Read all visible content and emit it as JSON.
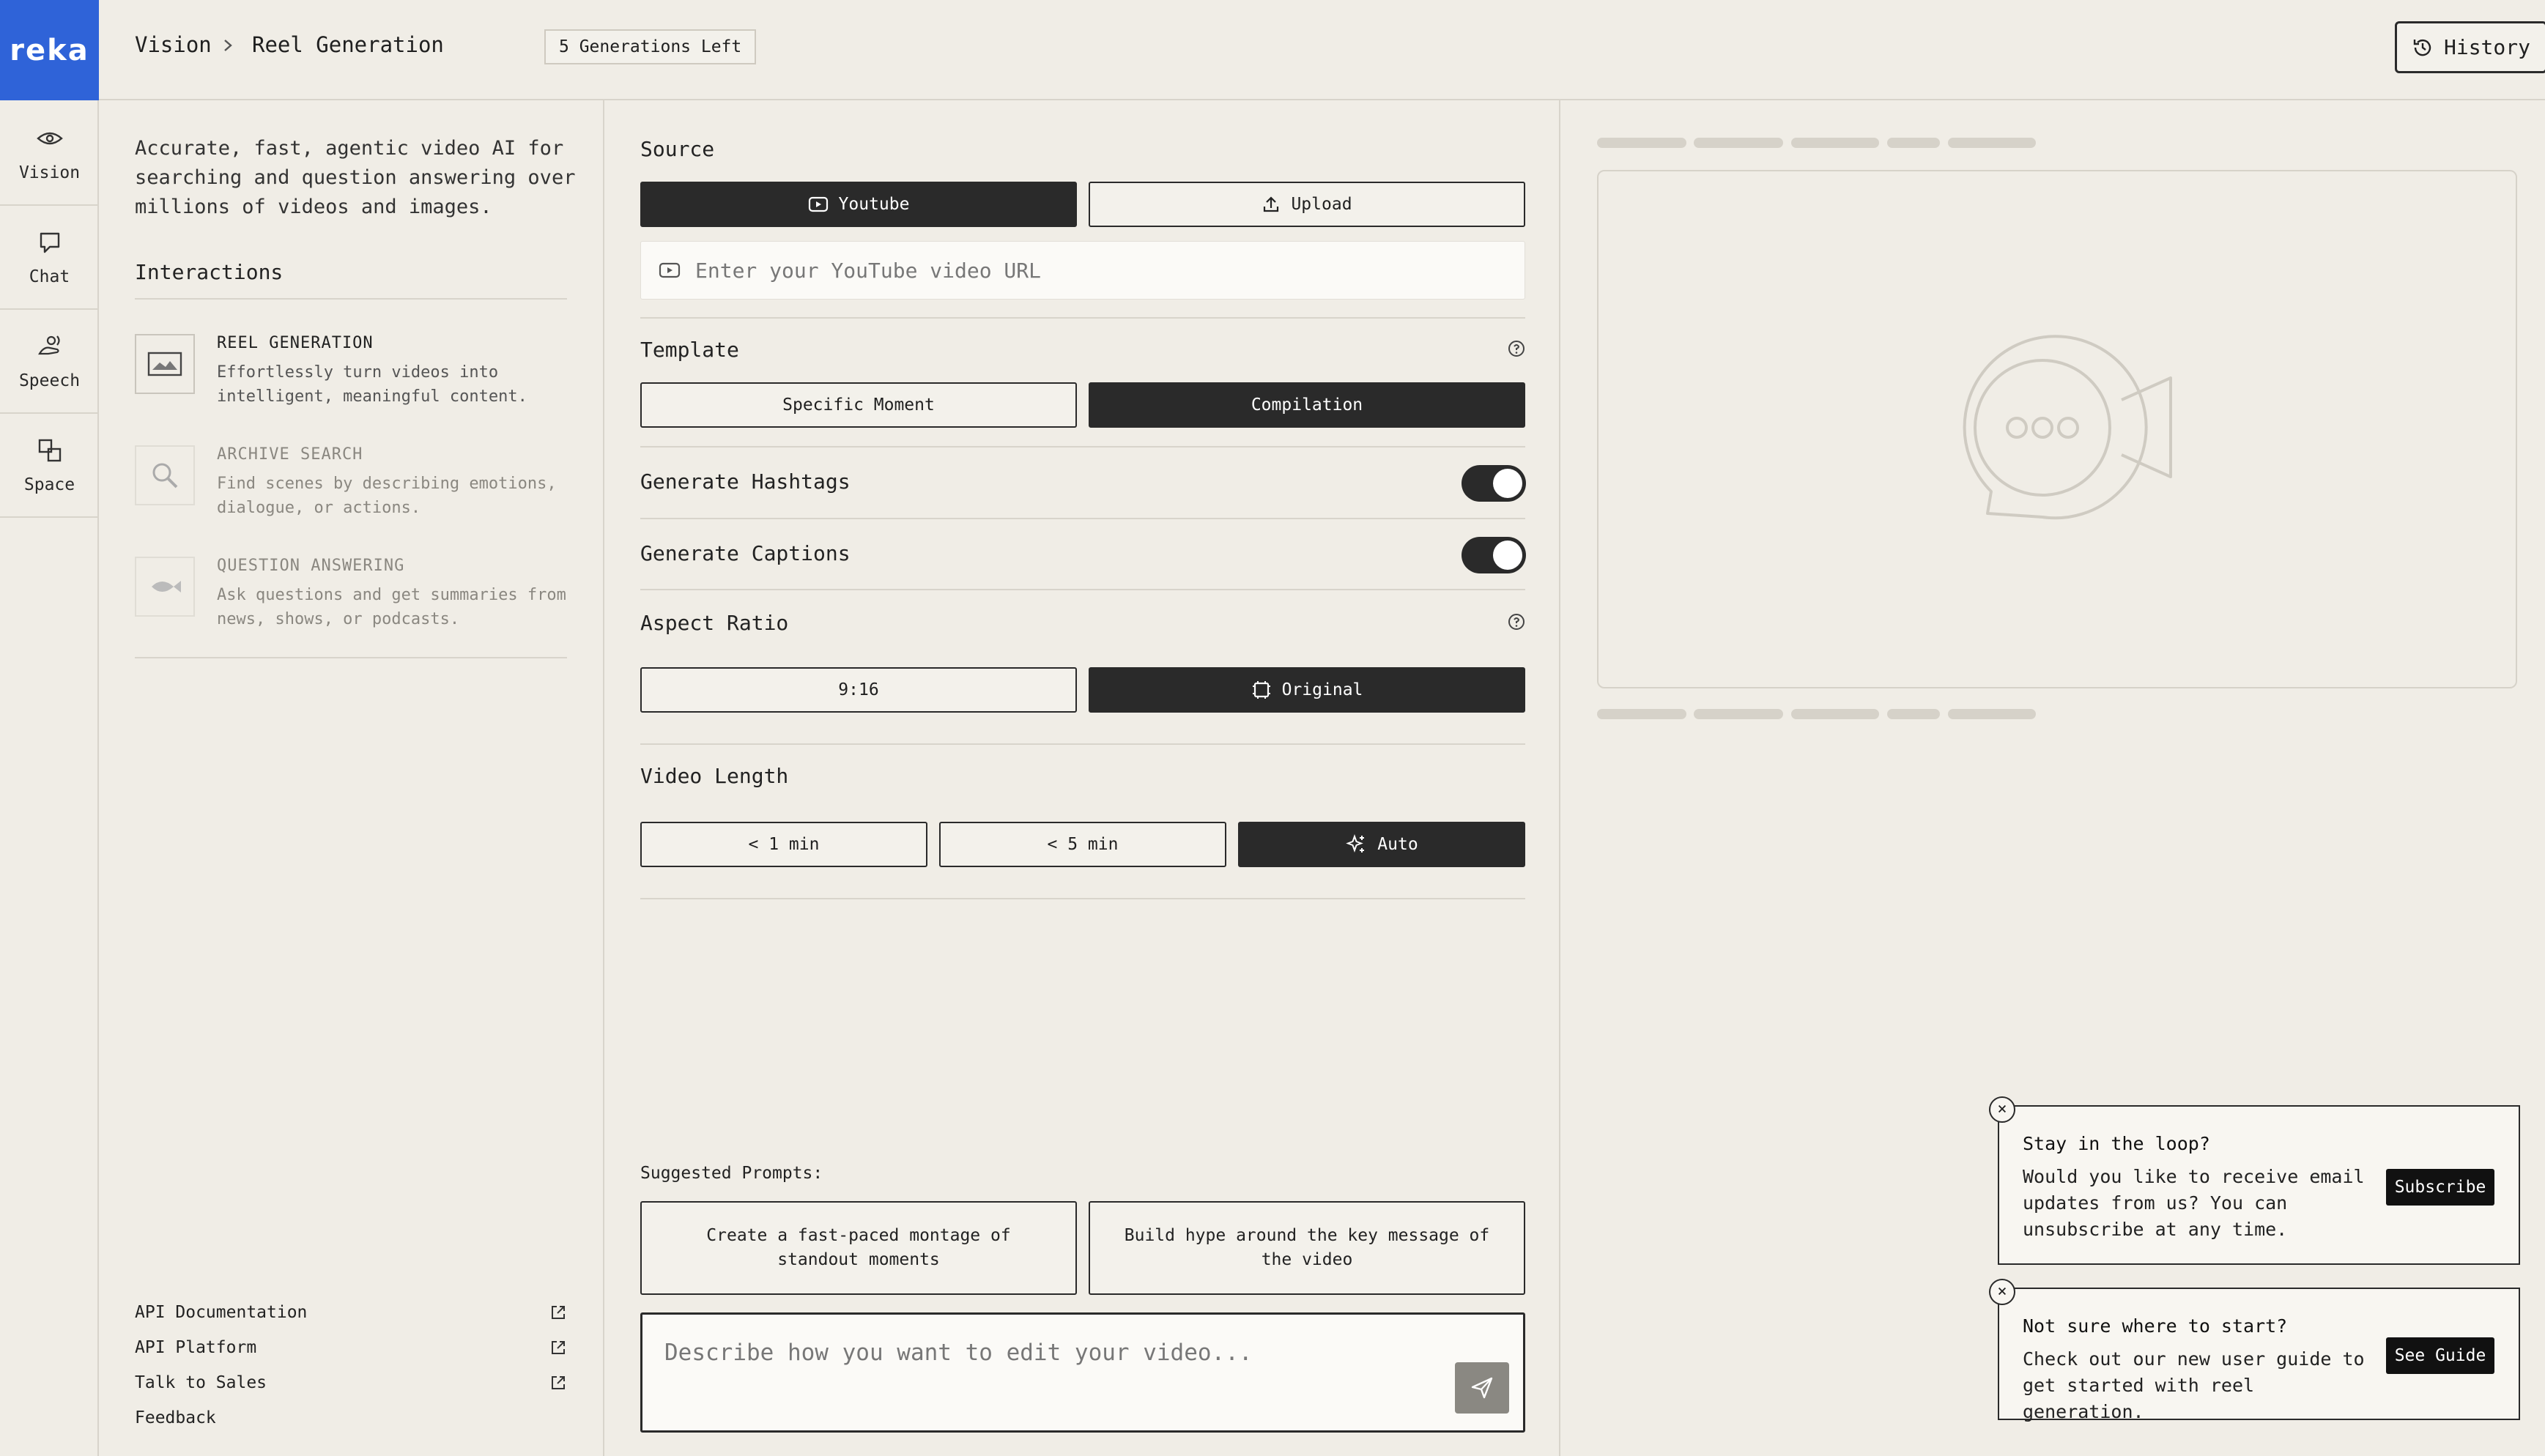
{
  "app": {
    "logo_text": "reka",
    "nav": [
      {
        "label": "Vision",
        "icon": "eye-icon"
      },
      {
        "label": "Chat",
        "icon": "chat-bubble-icon"
      },
      {
        "label": "Speech",
        "icon": "speech-icon"
      },
      {
        "label": "Space",
        "icon": "space-icon"
      }
    ]
  },
  "header": {
    "breadcrumb": [
      "Vision",
      "Reel Generation"
    ],
    "generations_badge": "5 Generations Left",
    "history_label": "History"
  },
  "left": {
    "tagline": "Accurate, fast, agentic video AI for searching and question answering over millions of videos and images.",
    "interactions_title": "Interactions",
    "interactions": [
      {
        "title": "REEL GENERATION",
        "desc": "Effortlessly turn videos into intelligent, meaningful content.",
        "icon": "video-frame-icon"
      },
      {
        "title": "ARCHIVE SEARCH",
        "desc": "Find scenes by describing emotions, dialogue, or actions.",
        "icon": "magnifier-icon"
      },
      {
        "title": "QUESTION ANSWERING",
        "desc": "Ask questions and get summaries from news, shows, or podcasts.",
        "icon": "fish-icon"
      }
    ],
    "footer_links": [
      {
        "label": "API Documentation",
        "external": true
      },
      {
        "label": "API Platform",
        "external": true
      },
      {
        "label": "Talk to Sales",
        "external": true
      },
      {
        "label": "Feedback",
        "external": false
      }
    ]
  },
  "form": {
    "source_label": "Source",
    "source_options": [
      {
        "label": "Youtube",
        "selected": true
      },
      {
        "label": "Upload",
        "selected": false
      }
    ],
    "url_placeholder": "Enter your YouTube video URL",
    "template_label": "Template",
    "template_options": [
      {
        "label": "Specific Moment",
        "selected": false
      },
      {
        "label": "Compilation",
        "selected": true
      }
    ],
    "hashtags_label": "Generate Hashtags",
    "hashtags_on": true,
    "captions_label": "Generate Captions",
    "captions_on": true,
    "aspect_label": "Aspect Ratio",
    "aspect_options": [
      {
        "label": "9:16",
        "selected": false
      },
      {
        "label": "Original",
        "selected": true
      }
    ],
    "length_label": "Video Length",
    "length_options": [
      {
        "label": "< 1 min",
        "selected": false
      },
      {
        "label": "< 5 min",
        "selected": false
      },
      {
        "label": "Auto",
        "selected": true
      }
    ],
    "suggested_label": "Suggested Prompts:",
    "suggested": [
      "Create a fast-paced montage of standout moments",
      "Build hype around the key message of the video"
    ],
    "edit_placeholder": "Describe how you want to edit your video..."
  },
  "popups": {
    "subscribe": {
      "title": "Stay in the loop?",
      "body": "Would you like to receive email updates from us? You can unsubscribe at any time.",
      "button": "Subscribe"
    },
    "guide": {
      "title": "Not sure where to start?",
      "body": "Check out our new user guide to get started with reel generation.",
      "button": "See Guide"
    }
  },
  "colors": {
    "brand": "#2f63d8",
    "dark": "#2a2a2a",
    "background": "#f0ede6"
  }
}
